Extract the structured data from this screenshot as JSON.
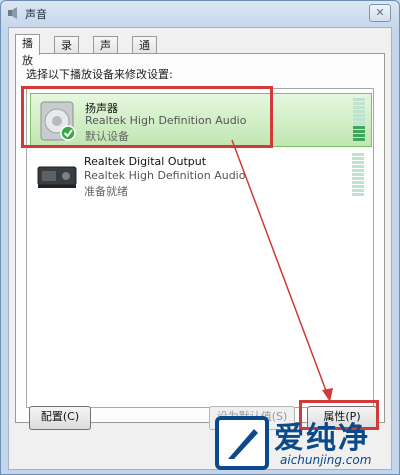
{
  "window": {
    "title": "声音",
    "close_glyph": "✕"
  },
  "tabs": [
    {
      "label": "播放",
      "active": true
    },
    {
      "label": "录制",
      "active": false
    },
    {
      "label": "声音",
      "active": false
    },
    {
      "label": "通信",
      "active": false
    }
  ],
  "instruction": "选择以下播放设备来修改设置:",
  "devices": [
    {
      "name": "扬声器",
      "description": "Realtek High Definition Audio",
      "status": "默认设备",
      "icon": "speaker-icon",
      "selected": true
    },
    {
      "name": "Realtek Digital Output",
      "description": "Realtek High Definition Audio",
      "status": "准备就绪",
      "icon": "digital-output-icon",
      "selected": false
    }
  ],
  "buttons": {
    "configure": "配置(C)",
    "set_default": "设为默认值(S)",
    "properties": "属性(P)"
  },
  "watermark": {
    "brand_cn": "爱纯净",
    "url": "aichunjing.com"
  },
  "colors": {
    "highlight": "#d23a3a",
    "selected_bg": "#bfe7b0",
    "watermark": "#0b4a8a"
  }
}
